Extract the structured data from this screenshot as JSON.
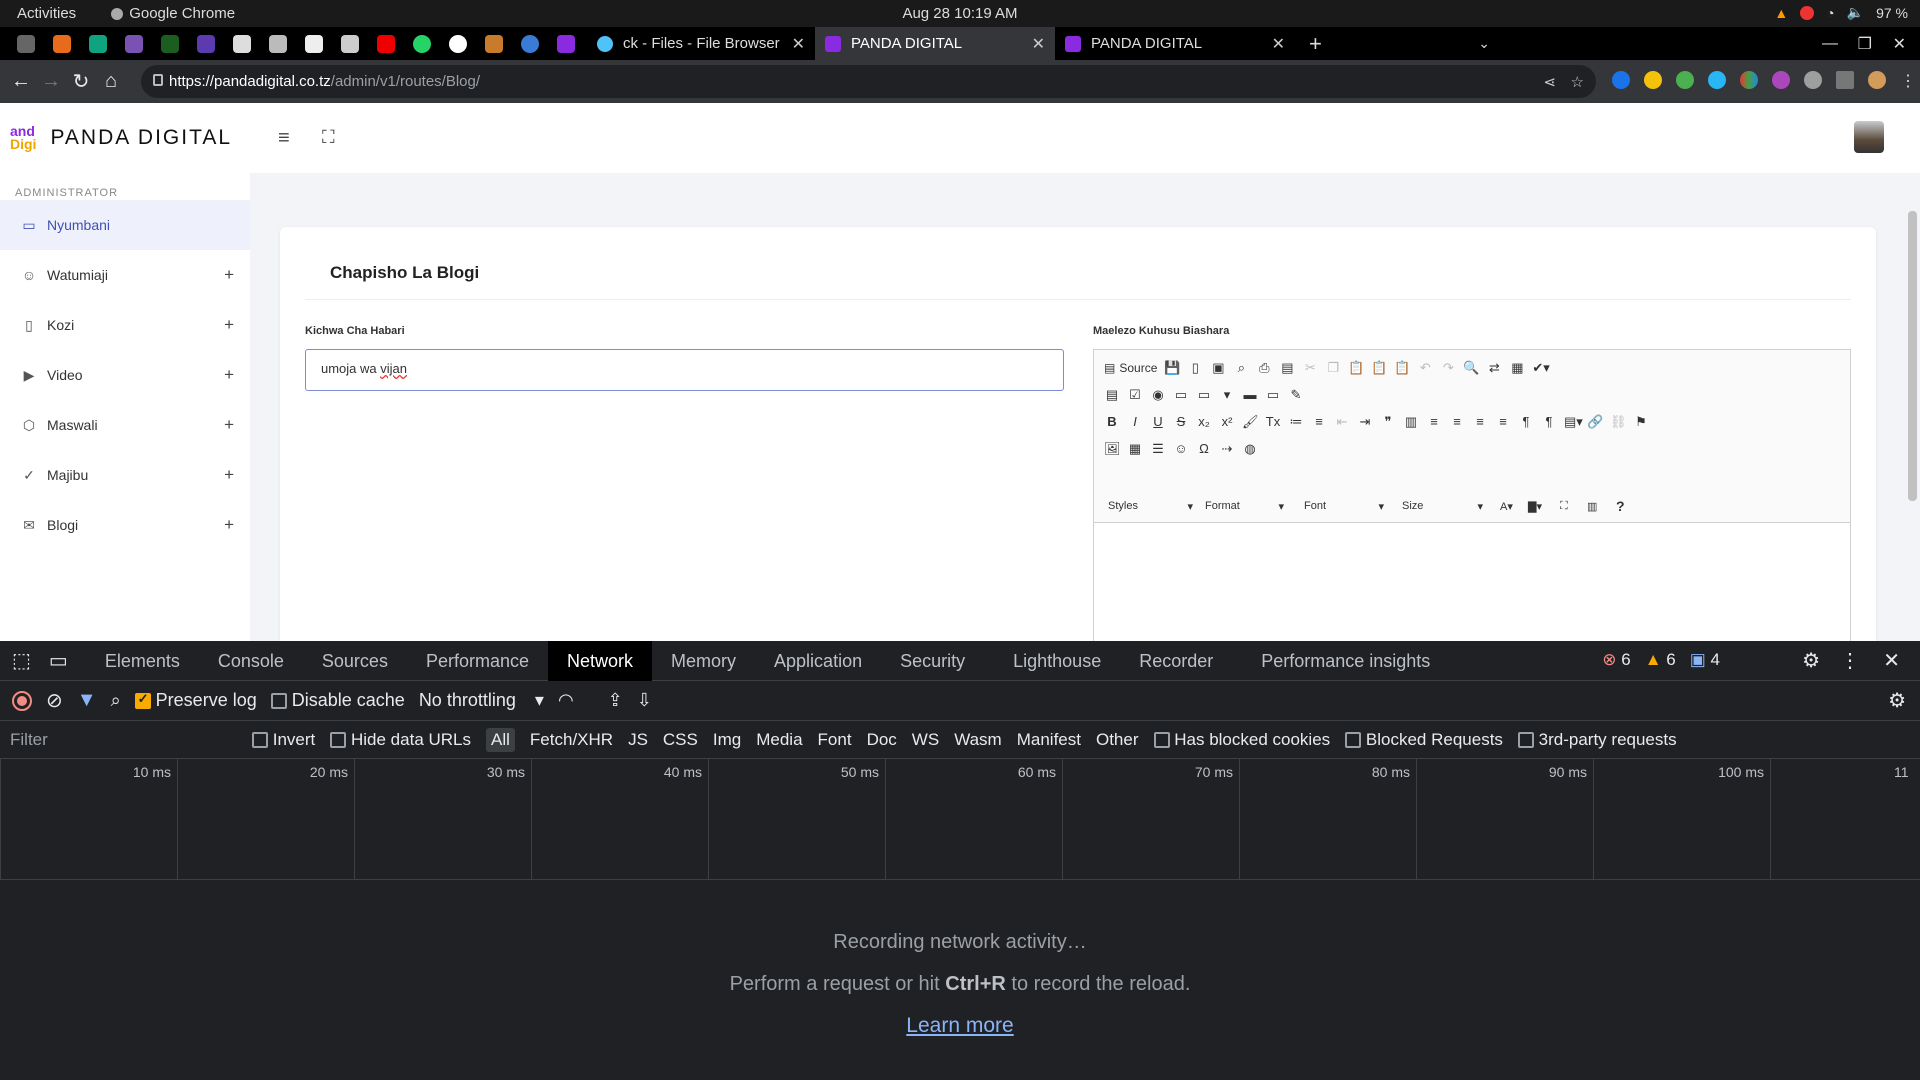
{
  "os": {
    "activities": "Activities",
    "app": "Google Chrome",
    "clock": "Aug 28  10:19 AM",
    "battery": "97 %"
  },
  "browser": {
    "tabs": [
      {
        "title": "ck - Files - File Browser"
      },
      {
        "title": "PANDA DIGITAL"
      },
      {
        "title": "PANDA DIGITAL"
      }
    ],
    "url_host": "https://pandadigital.co.tz",
    "url_path": "/admin/v1/routes/Blog/"
  },
  "app": {
    "logo_mark_top": "and",
    "logo_mark_bottom": "Digi",
    "brand": "PANDA DIGITAL",
    "section": "ADMINISTRATOR",
    "menu": [
      {
        "label": "Nyumbani",
        "icon": "monitor-icon"
      },
      {
        "label": "Watumiaji",
        "icon": "user-icon"
      },
      {
        "label": "Kozi",
        "icon": "book-icon"
      },
      {
        "label": "Video",
        "icon": "video-icon"
      },
      {
        "label": "Maswali",
        "icon": "box-icon"
      },
      {
        "label": "Majibu",
        "icon": "check-icon"
      },
      {
        "label": "Blogi",
        "icon": "mail-icon"
      }
    ]
  },
  "form": {
    "card_title": "Chapisho La Blogi",
    "title_label": "Kichwa Cha Habari",
    "title_value_a": "umoja wa ",
    "title_value_b": "vijan",
    "desc_label": "Maelezo Kuhusu Biashara",
    "editor": {
      "source": "Source",
      "styles": "Styles",
      "format": "Format",
      "font": "Font",
      "size": "Size",
      "help": "?"
    }
  },
  "devtools": {
    "tabs": [
      "Elements",
      "Console",
      "Sources",
      "Performance",
      "Network",
      "Memory",
      "Application",
      "Security",
      "Lighthouse",
      "Recorder",
      "Performance insights"
    ],
    "active_tab": "Network",
    "errors": "6",
    "warnings": "6",
    "messages": "4",
    "preserve_log": "Preserve log",
    "disable_cache": "Disable cache",
    "throttling": "No throttling",
    "filter_placeholder": "Filter",
    "invert": "Invert",
    "hide_data_urls": "Hide data URLs",
    "types": [
      "All",
      "Fetch/XHR",
      "JS",
      "CSS",
      "Img",
      "Media",
      "Font",
      "Doc",
      "WS",
      "Wasm",
      "Manifest",
      "Other"
    ],
    "has_blocked_cookies": "Has blocked cookies",
    "blocked_requests": "Blocked Requests",
    "third_party": "3rd-party requests",
    "ticks": [
      "10 ms",
      "20 ms",
      "30 ms",
      "40 ms",
      "50 ms",
      "60 ms",
      "70 ms",
      "80 ms",
      "90 ms",
      "100 ms",
      "11"
    ],
    "recording": "Recording network activity…",
    "hint_a": "Perform a request or hit ",
    "hint_key": "Ctrl+R",
    "hint_b": " to record the reload.",
    "learn_more": "Learn more"
  },
  "colors": {
    "accent": "#3f51b5",
    "devtools_bg": "#202124",
    "warning": "#f9ab00",
    "error": "#f28b82"
  }
}
